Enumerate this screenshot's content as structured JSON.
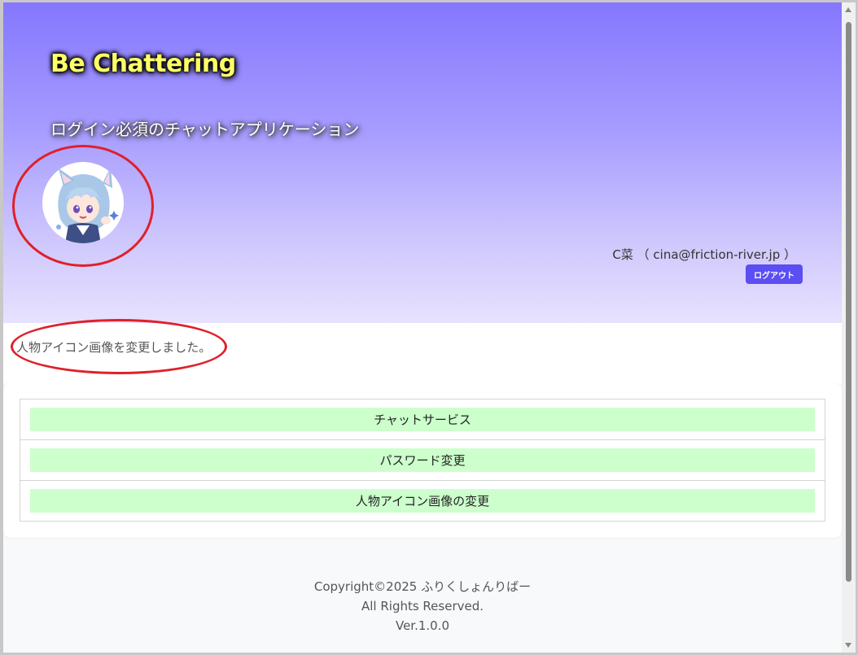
{
  "header": {
    "app_title": "Be Chattering",
    "subtitle": "ログイン必須のチャットアプリケーション",
    "avatar_icon": "anime-cat-girl-avatar",
    "user_info": "C菜 （ cina@friction-river.jp ）",
    "logout_label": "ログアウト"
  },
  "message": {
    "text": "人物アイコン画像を変更しました。"
  },
  "menu": {
    "items": [
      {
        "label": "チャットサービス"
      },
      {
        "label": "パスワード変更"
      },
      {
        "label": "人物アイコン画像の変更"
      }
    ]
  },
  "footer": {
    "copyright": "Copyright©2025 ふりくしょんりばー",
    "rights": "All Rights Reserved.",
    "version": "Ver.1.0.0"
  },
  "colors": {
    "header_top": "#8577fe",
    "header_bottom": "#e7e2fe",
    "title_yellow": "#ffff66",
    "logout_button": "#5b4ef2",
    "menu_button": "#ccffcc",
    "annotation_red": "#e0202a"
  }
}
